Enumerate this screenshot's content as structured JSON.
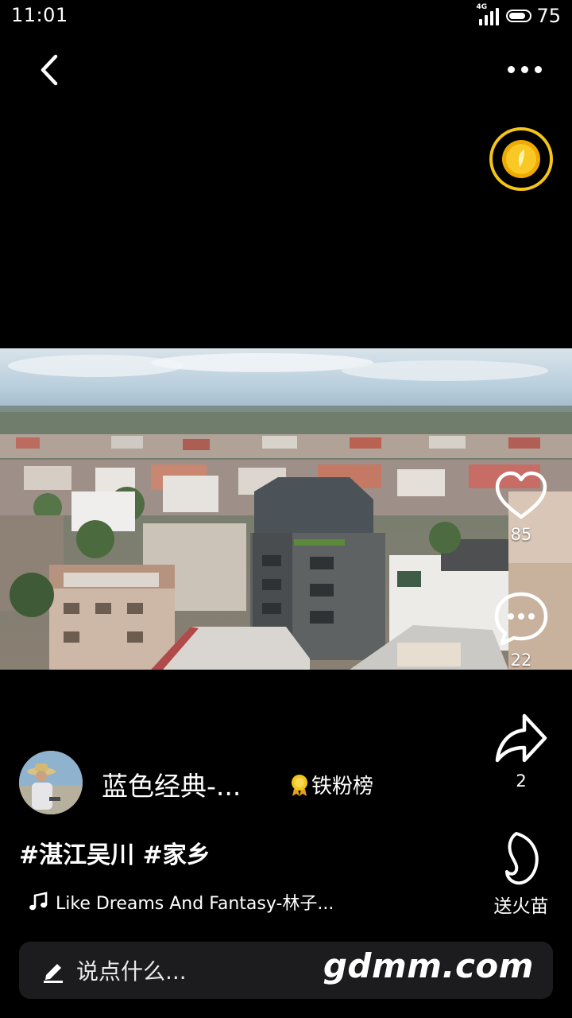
{
  "status_bar": {
    "time": "11:01",
    "network": "4G",
    "battery": "75"
  },
  "post": {
    "author_name": "蓝色经典-...",
    "fan_rank_label": "铁粉榜",
    "hashtags": "#湛江吴川 #家乡",
    "music": "Like Dreams And Fantasy-林子..."
  },
  "actions": {
    "likes": "85",
    "comments": "22",
    "shares": "2",
    "gift_label": "送火苗"
  },
  "comment_box": {
    "placeholder": "说点什么..."
  },
  "watermark": "gdmm.com",
  "colors": {
    "background": "#000000",
    "coin": "#f5c518",
    "input_bg": "#1c1c1e"
  }
}
